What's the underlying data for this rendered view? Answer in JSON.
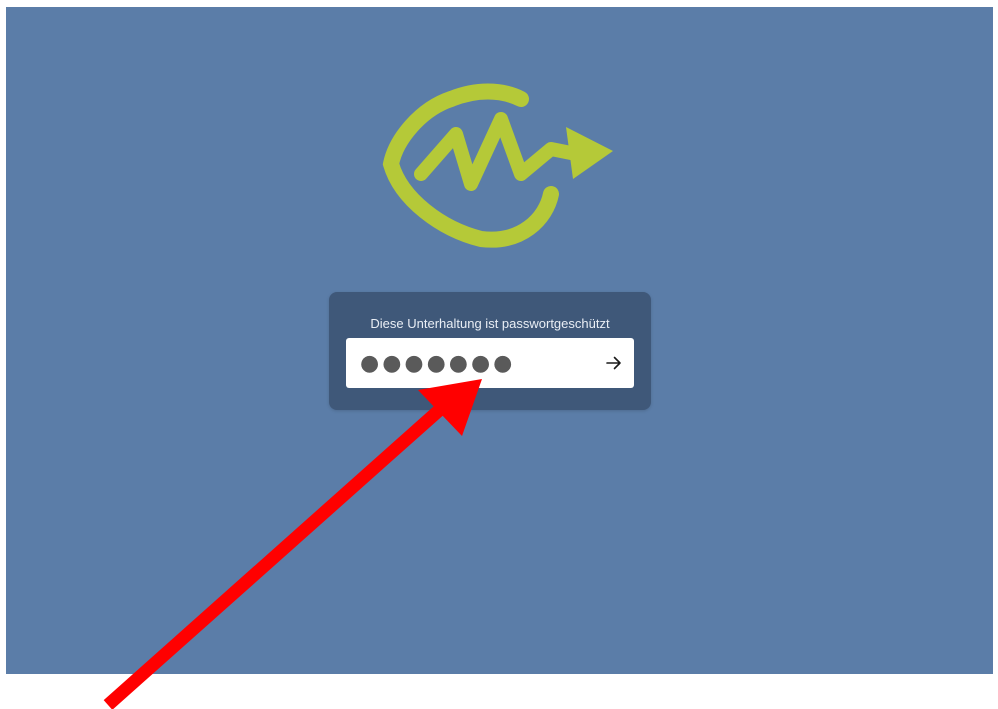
{
  "colors": {
    "background": "#5b7da8",
    "card": "#3f5879",
    "logo": "#b5c938",
    "annotation_arrow": "#ff0000"
  },
  "dialog": {
    "label": "Diese Unterhaltung ist passwortgeschützt",
    "password_value": "●●●●●●●",
    "submit_icon": "arrow-right-icon"
  },
  "logo": {
    "icon": "speech-bubble-arrow-logo"
  },
  "annotation": {
    "icon": "red-arrow-pointer"
  }
}
